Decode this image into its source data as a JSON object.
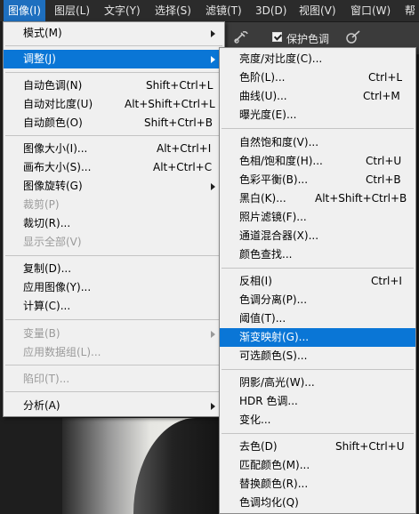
{
  "menubar": {
    "items": [
      {
        "label": "图像(I)",
        "active": true
      },
      {
        "label": "图层(L)"
      },
      {
        "label": "文字(Y)"
      },
      {
        "label": "选择(S)"
      },
      {
        "label": "滤镜(T)"
      },
      {
        "label": "3D(D)"
      },
      {
        "label": "视图(V)"
      },
      {
        "label": "窗口(W)"
      },
      {
        "label": "帮"
      }
    ]
  },
  "options_bar": {
    "airbrush_icon": "airbrush-icon",
    "protect_tones_label": "保护色调",
    "protect_tones_checked": true,
    "pressure_icon": "pressure-icon"
  },
  "image_menu": {
    "mode": "模式(M)",
    "adjustments": "调整(J)",
    "auto_tone": "自动色调(N)",
    "auto_tone_sc": "Shift+Ctrl+L",
    "auto_contrast": "自动对比度(U)",
    "auto_contrast_sc": "Alt+Shift+Ctrl+L",
    "auto_color": "自动颜色(O)",
    "auto_color_sc": "Shift+Ctrl+B",
    "image_size": "图像大小(I)...",
    "image_size_sc": "Alt+Ctrl+I",
    "canvas_size": "画布大小(S)...",
    "canvas_size_sc": "Alt+Ctrl+C",
    "image_rotation": "图像旋转(G)",
    "crop": "裁剪(P)",
    "trim": "裁切(R)...",
    "reveal_all": "显示全部(V)",
    "duplicate": "复制(D)...",
    "apply_image": "应用图像(Y)...",
    "calculations": "计算(C)...",
    "variables": "变量(B)",
    "apply_data_set": "应用数据组(L)...",
    "trap": "陷印(T)...",
    "analysis": "分析(A)"
  },
  "adjust_menu": {
    "brightness_contrast": "亮度/对比度(C)...",
    "levels": "色阶(L)...",
    "levels_sc": "Ctrl+L",
    "curves": "曲线(U)...",
    "curves_sc": "Ctrl+M",
    "exposure": "曝光度(E)...",
    "vibrance": "自然饱和度(V)...",
    "hue_saturation": "色相/饱和度(H)...",
    "hue_saturation_sc": "Ctrl+U",
    "color_balance": "色彩平衡(B)...",
    "color_balance_sc": "Ctrl+B",
    "black_white": "黑白(K)...",
    "black_white_sc": "Alt+Shift+Ctrl+B",
    "photo_filter": "照片滤镜(F)...",
    "channel_mixer": "通道混合器(X)...",
    "color_lookup": "颜色查找...",
    "invert": "反相(I)",
    "invert_sc": "Ctrl+I",
    "posterize": "色调分离(P)...",
    "threshold": "阈值(T)...",
    "gradient_map": "渐变映射(G)...",
    "selective_color": "可选颜色(S)...",
    "shadows_highlights": "阴影/高光(W)...",
    "hdr_toning": "HDR 色调...",
    "variations": "变化...",
    "desaturate": "去色(D)",
    "desaturate_sc": "Shift+Ctrl+U",
    "match_color": "匹配颜色(M)...",
    "replace_color": "替换颜色(R)...",
    "equalize": "色调均化(Q)"
  },
  "colors": {
    "highlight": "#0a76d6",
    "menu_bg": "#f0f0f0",
    "menubar_bg": "#2b2b2b"
  }
}
